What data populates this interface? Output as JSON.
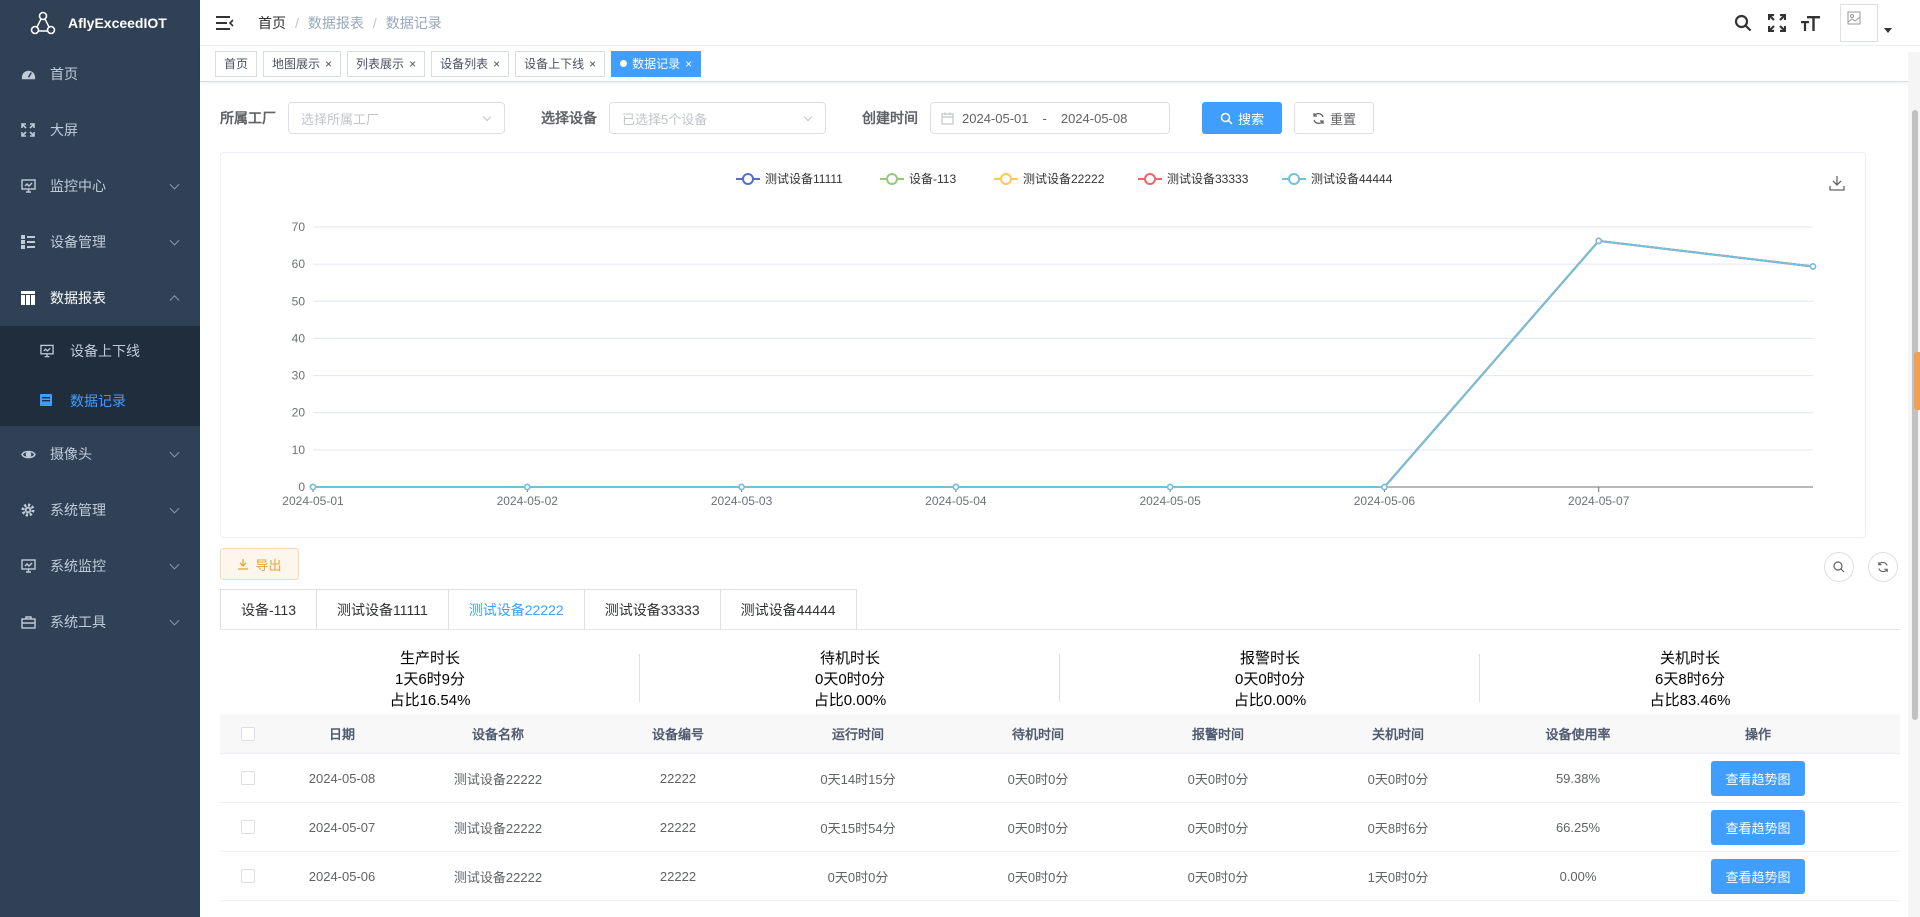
{
  "app": {
    "title": "AflyExceedIOT"
  },
  "sidebar": {
    "items": [
      {
        "label": "首页",
        "icon": "dashboard-icon"
      },
      {
        "label": "大屏",
        "icon": "fullscreen-icon"
      },
      {
        "label": "监控中心",
        "icon": "monitor-icon"
      },
      {
        "label": "设备管理",
        "icon": "tree-table-icon"
      },
      {
        "label": "数据报表",
        "icon": "table-icon"
      },
      {
        "label": "摄像头",
        "icon": "eye-icon"
      },
      {
        "label": "系统管理",
        "icon": "gear-icon"
      },
      {
        "label": "系统监控",
        "icon": "monitor-icon"
      },
      {
        "label": "系统工具",
        "icon": "toolbox-icon"
      }
    ],
    "sub": [
      {
        "label": "设备上下线"
      },
      {
        "label": "数据记录"
      }
    ]
  },
  "breadcrumb": [
    "首页",
    "数据报表",
    "数据记录"
  ],
  "tags": [
    "首页",
    "地图展示",
    "列表展示",
    "设备列表",
    "设备上下线",
    "数据记录"
  ],
  "filters": {
    "factory_label": "所属工厂",
    "factory_placeholder": "选择所属工厂",
    "device_label": "选择设备",
    "device_placeholder": "已选择5个设备",
    "time_label": "创建时间",
    "date_start": "2024-05-01",
    "date_sep": "-",
    "date_end": "2024-05-08",
    "search": "搜索",
    "reset": "重置"
  },
  "chart_data": {
    "type": "line",
    "x": [
      "2024-05-01",
      "2024-05-02",
      "2024-05-03",
      "2024-05-04",
      "2024-05-05",
      "2024-05-06",
      "2024-05-07",
      "2024-05-08"
    ],
    "x_tick_labels": [
      "2024-05-01",
      "2024-05-02",
      "2024-05-03",
      "2024-05-04",
      "2024-05-05",
      "2024-05-06",
      "2024-05-07"
    ],
    "ylim": [
      0,
      70
    ],
    "yticks": [
      0,
      10,
      20,
      30,
      40,
      50,
      60,
      70
    ],
    "grid": true,
    "legend": "top-center",
    "series": [
      {
        "name": "测试设备11111",
        "color": "#5470c6",
        "values": [
          0,
          0,
          0,
          0,
          0,
          0,
          66.25,
          59.38
        ]
      },
      {
        "name": "设备-113",
        "color": "#91cc75",
        "values": [
          0,
          0,
          0,
          0,
          0,
          0,
          66.25,
          59.38
        ]
      },
      {
        "name": "测试设备22222",
        "color": "#fac858",
        "values": [
          0,
          0,
          0,
          0,
          0,
          0,
          66.25,
          59.38
        ]
      },
      {
        "name": "测试设备33333",
        "color": "#ee6666",
        "values": [
          0,
          0,
          0,
          0,
          0,
          0,
          66.25,
          59.38
        ]
      },
      {
        "name": "测试设备44444",
        "color": "#73c0de",
        "values": [
          0,
          0,
          0,
          0,
          0,
          0,
          66.25,
          59.38
        ]
      }
    ]
  },
  "export_label": "导出",
  "tabs": [
    "设备-113",
    "测试设备11111",
    "测试设备22222",
    "测试设备33333",
    "测试设备44444"
  ],
  "stats": [
    {
      "title": "生产时长",
      "value": "1天6时9分",
      "ratio": "占比16.54%"
    },
    {
      "title": "待机时长",
      "value": "0天0时0分",
      "ratio": "占比0.00%"
    },
    {
      "title": "报警时长",
      "value": "0天0时0分",
      "ratio": "占比0.00%"
    },
    {
      "title": "关机时长",
      "value": "6天8时6分",
      "ratio": "占比83.46%"
    }
  ],
  "table": {
    "headers": [
      "日期",
      "设备名称",
      "设备编号",
      "运行时间",
      "待机时间",
      "报警时间",
      "关机时间",
      "设备使用率",
      "操作"
    ],
    "rows": [
      [
        "2024-05-08",
        "测试设备22222",
        "22222",
        "0天14时15分",
        "0天0时0分",
        "0天0时0分",
        "0天0时0分",
        "59.38%",
        "查看趋势图"
      ],
      [
        "2024-05-07",
        "测试设备22222",
        "22222",
        "0天15时54分",
        "0天0时0分",
        "0天0时0分",
        "0天8时6分",
        "66.25%",
        "查看趋势图"
      ],
      [
        "2024-05-06",
        "测试设备22222",
        "22222",
        "0天0时0分",
        "0天0时0分",
        "0天0时0分",
        "1天0时0分",
        "0.00%",
        "查看趋势图"
      ]
    ]
  }
}
